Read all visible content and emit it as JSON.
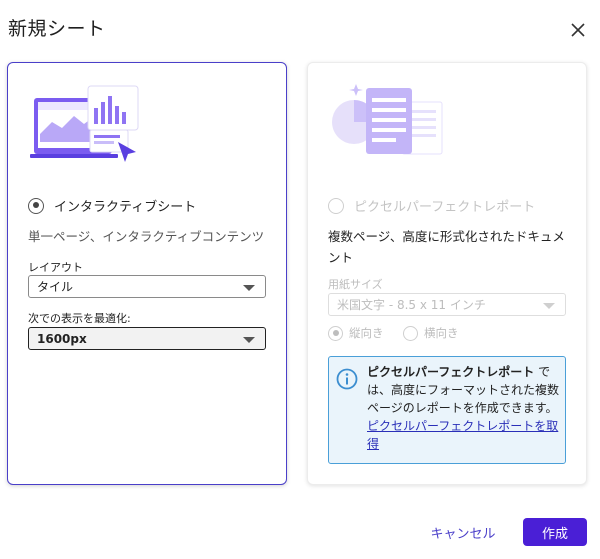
{
  "dialog": {
    "title": "新規シート",
    "close_icon": "close-icon"
  },
  "interactive": {
    "option_label": "インタラクティブシート",
    "description": "単一ページ、インタラクティブコンテンツ",
    "layout_label": "レイアウト",
    "layout_value": "タイル",
    "optimize_label": "次での表示を最適化:",
    "optimize_value": "1600px",
    "selected": true
  },
  "pixel_perfect": {
    "option_label": "ピクセルパーフェクトレポート",
    "description": "複数ページ、高度に形式化されたドキュメント",
    "paper_label": "用紙サイズ",
    "paper_value": "米国文字 - 8.5 x 11 インチ",
    "orientation_portrait": "縦向き",
    "orientation_landscape": "横向き",
    "info_bold": "ピクセルパーフェクトレポート",
    "info_text": " では、高度にフォーマットされた複数ページのレポートを作成できます。",
    "info_link": "ピクセルパーフェクトレポートを取得",
    "disabled": true
  },
  "footer": {
    "cancel_label": "キャンセル",
    "create_label": "作成"
  },
  "colors": {
    "accent": "#4a1fd6",
    "selected_border": "#4a3fc9",
    "info_border": "#4a9fd8",
    "info_bg": "#eaf4fb"
  }
}
